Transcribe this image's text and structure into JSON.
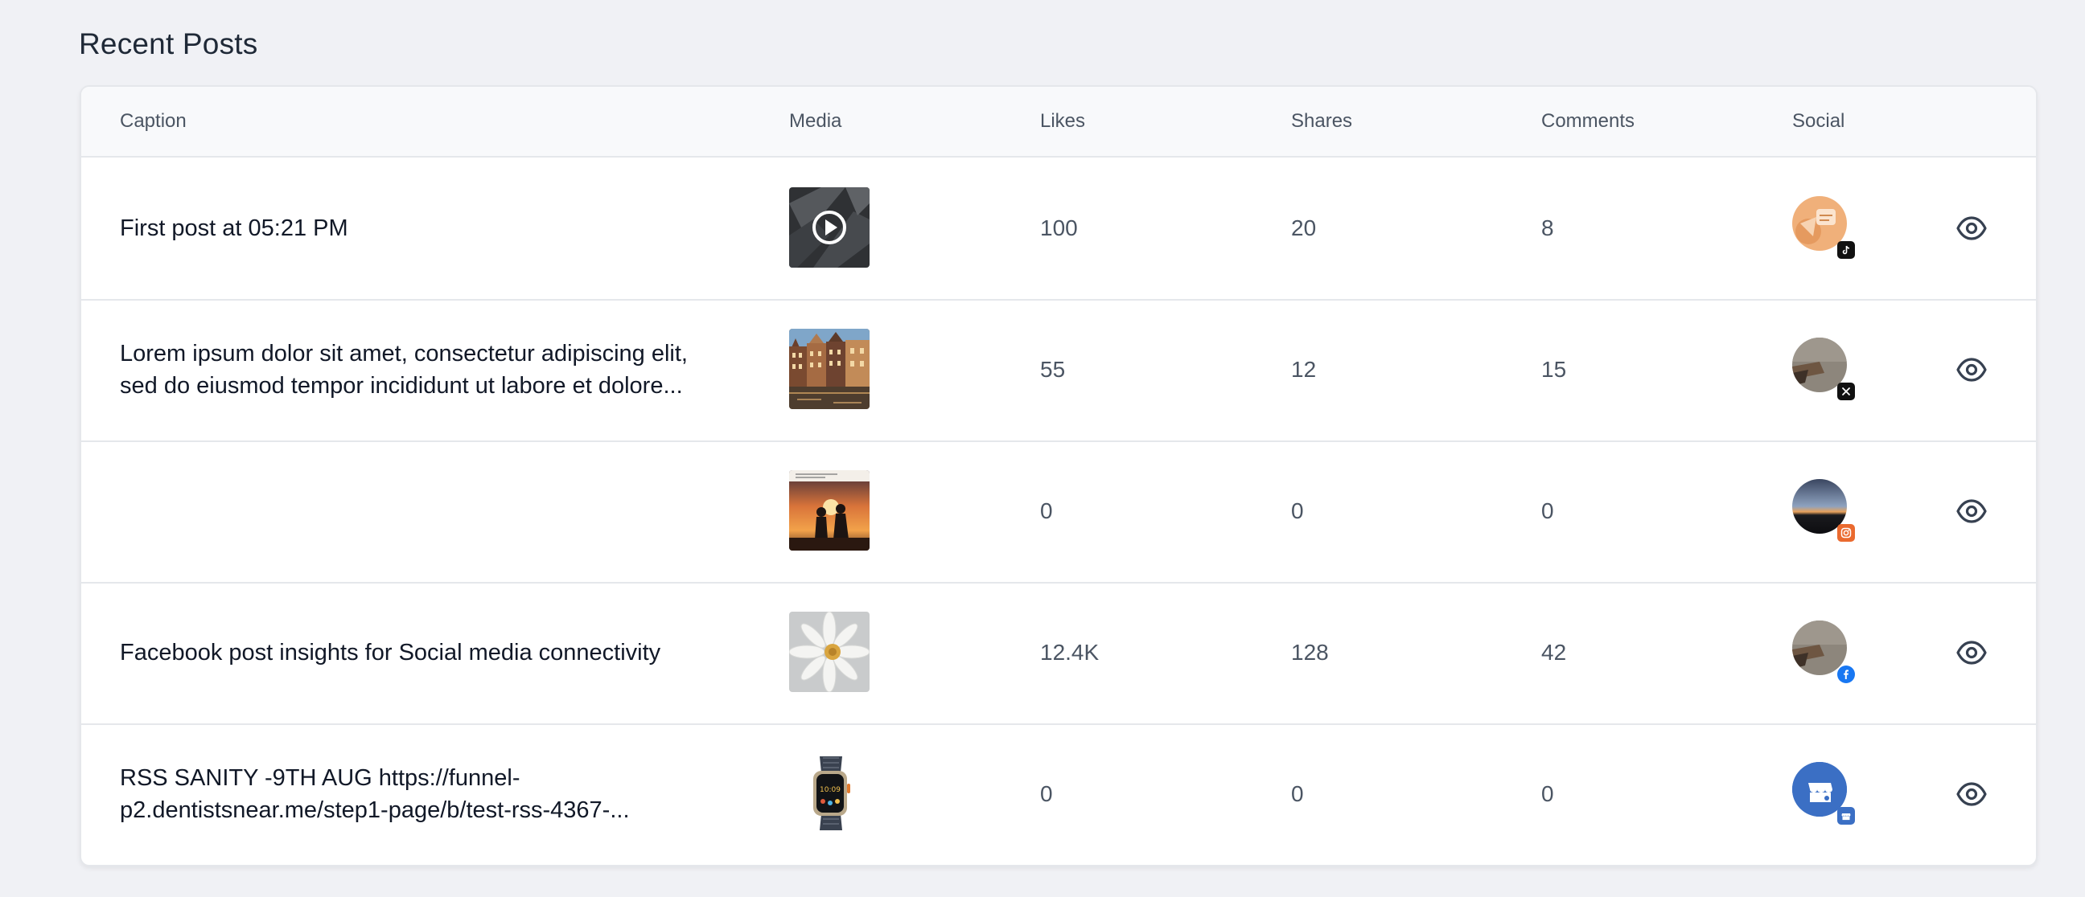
{
  "page": {
    "title": "Recent Posts"
  },
  "table": {
    "headers": {
      "caption": "Caption",
      "media": "Media",
      "likes": "Likes",
      "shares": "Shares",
      "comments": "Comments",
      "social": "Social"
    },
    "rows": [
      {
        "caption": "First post at 05:21 PM",
        "media": "video-thumbnail",
        "likes": "100",
        "shares": "20",
        "comments": "8",
        "social": "tiktok"
      },
      {
        "caption": "Lorem ipsum dolor sit amet, consectetur adipiscing elit, sed do eiusmod tempor incididunt ut labore et dolore...",
        "media": "buildings-photo",
        "likes": "55",
        "shares": "12",
        "comments": "15",
        "social": "x"
      },
      {
        "caption": "",
        "media": "sunset-couple-photo",
        "likes": "0",
        "shares": "0",
        "comments": "0",
        "social": "instagram"
      },
      {
        "caption": "Facebook post insights for Social media connectivity",
        "media": "daisy-photo",
        "likes": "12.4K",
        "shares": "128",
        "comments": "42",
        "social": "facebook"
      },
      {
        "caption": "RSS SANITY -9TH AUG    https://funnel-p2.dentistsnear.me/step1-page/b/test-rss-4367-...",
        "media": "smartwatch-photo",
        "likes": "0",
        "shares": "0",
        "comments": "0",
        "social": "google-business"
      }
    ]
  },
  "icons": {
    "view": "eye-icon",
    "play": "play-icon"
  },
  "colors": {
    "background": "#f0f1f5",
    "header_bg": "#f8f9fb",
    "border": "#e5e7eb",
    "muted_text": "#4b5563",
    "facebook": "#1877f2",
    "google_business": "#3b6fc4"
  }
}
